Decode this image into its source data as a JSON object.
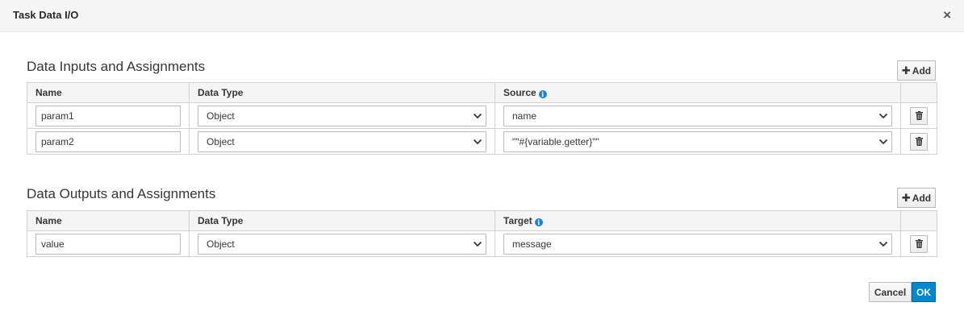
{
  "dialog": {
    "title": "Task Data I/O",
    "close_symbol": "×"
  },
  "inputs": {
    "title": "Data Inputs and Assignments",
    "add_label": "Add",
    "headers": {
      "name": "Name",
      "data_type": "Data Type",
      "source": "Source"
    },
    "rows": [
      {
        "name": "param1",
        "data_type": "Object",
        "source": "name"
      },
      {
        "name": "param2",
        "data_type": "Object",
        "source": "\"\"#{variable.getter}\"\""
      }
    ]
  },
  "outputs": {
    "title": "Data Outputs and Assignments",
    "add_label": "Add",
    "headers": {
      "name": "Name",
      "data_type": "Data Type",
      "target": "Target"
    },
    "rows": [
      {
        "name": "value",
        "data_type": "Object",
        "target": "message"
      }
    ]
  },
  "footer": {
    "cancel_label": "Cancel",
    "ok_label": "OK"
  },
  "colors": {
    "primary": "#0088ce",
    "info_icon": "#1b86cf",
    "header_bg": "#f5f5f5",
    "border": "#d1d1d1"
  },
  "icons": {
    "info": "info-icon",
    "delete": "trash-icon",
    "dropdown": "chevron-down-icon",
    "add": "plus-icon",
    "close": "close-icon"
  }
}
